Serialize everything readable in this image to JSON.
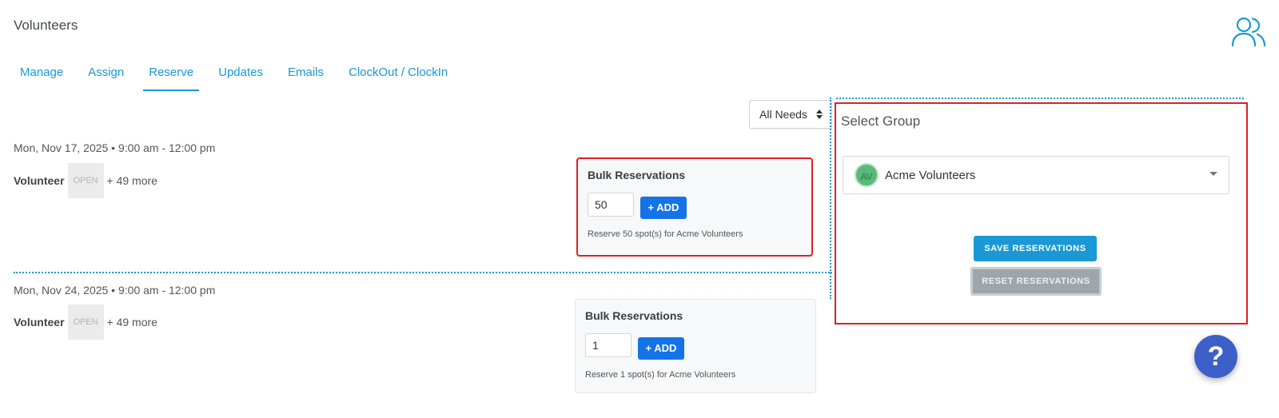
{
  "header": {
    "title": "Volunteers",
    "icon": "users-icon"
  },
  "tabs": [
    {
      "label": "Manage"
    },
    {
      "label": "Assign"
    },
    {
      "label": "Reserve",
      "active": true
    },
    {
      "label": "Updates"
    },
    {
      "label": "Emails"
    },
    {
      "label": "ClockOut / ClockIn"
    }
  ],
  "filter": {
    "selected": "All Needs"
  },
  "slots": [
    {
      "date": "Mon, Nov 17, 2025 • 9:00 am - 12:00 pm",
      "role": "Volunteer",
      "status": "OPEN",
      "more": "+ 49 more",
      "bulk": {
        "title": "Bulk Reservations",
        "value": "50",
        "add_label": "+ ADD",
        "hint": "Reserve 50 spot(s) for Acme Volunteers"
      }
    },
    {
      "date": "Mon, Nov 24, 2025 • 9:00 am - 12:00 pm",
      "role": "Volunteer",
      "status": "OPEN",
      "more": "+ 49 more",
      "bulk": {
        "title": "Bulk Reservations",
        "value": "1",
        "add_label": "+ ADD",
        "hint": "Reserve 1 spot(s) for Acme Volunteers"
      }
    }
  ],
  "group_panel": {
    "title": "Select Group",
    "selected_group": {
      "initials": "AV",
      "name": "Acme Volunteers"
    },
    "save_label": "SAVE RESERVATIONS",
    "reset_label": "RESET RESERVATIONS"
  },
  "help": {
    "label": "?"
  },
  "colors": {
    "accent": "#1a98d5",
    "add_button": "#1473e6",
    "highlight": "#e02020",
    "help_button": "#3d5fc8"
  }
}
